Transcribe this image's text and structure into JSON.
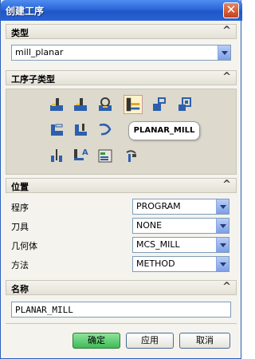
{
  "window": {
    "title": "创建工序",
    "close_glyph": "✕"
  },
  "type_section": {
    "header": "类型",
    "selected": "mill_planar"
  },
  "subtype_section": {
    "header": "工序子类型",
    "icons": [
      "face-mill-area-icon",
      "face-mill-icon",
      "face-mill-manual-icon",
      "planar-mill-icon",
      "planar-profile-icon",
      "cleanup-corners-icon",
      "finish-walls-icon",
      "finish-floor-icon",
      "groove-milling-icon",
      "hole-milling-icon",
      "thread-milling-icon",
      "planar-text-icon",
      "mill-control-icon",
      "mill-user-icon"
    ],
    "tooltip": "PLANAR_MILL",
    "text_icon_glyph": "A"
  },
  "position_section": {
    "header": "位置",
    "rows": [
      {
        "label": "程序",
        "value": "PROGRAM"
      },
      {
        "label": "刀具",
        "value": "NONE"
      },
      {
        "label": "几何体",
        "value": "MCS_MILL"
      },
      {
        "label": "方法",
        "value": "METHOD"
      }
    ]
  },
  "name_section": {
    "header": "名称",
    "value": "PLANAR_MILL"
  },
  "buttons": {
    "ok": "确定",
    "apply": "应用",
    "cancel": "取消"
  },
  "chevron": "^"
}
